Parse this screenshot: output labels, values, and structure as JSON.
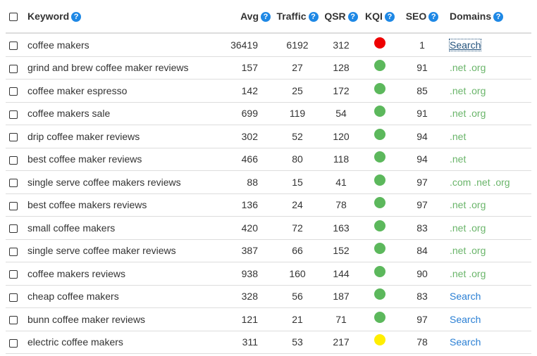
{
  "colors": {
    "help_icon": "#1e88e5",
    "kqi_green": "#5cb85c",
    "kqi_red": "#ee0000",
    "kqi_yellow": "#ffee00",
    "domain_text": "#6ab56a",
    "link": "#2a7fd4"
  },
  "header": {
    "select_all_icon": "checkbox-icon",
    "help_glyph": "?",
    "columns": [
      {
        "key": "keyword",
        "label": "Keyword"
      },
      {
        "key": "avg",
        "label": "Avg"
      },
      {
        "key": "traffic",
        "label": "Traffic"
      },
      {
        "key": "qsr",
        "label": "QSR"
      },
      {
        "key": "kqi",
        "label": "KQI"
      },
      {
        "key": "seo",
        "label": "SEO"
      },
      {
        "key": "domains",
        "label": "Domains"
      }
    ]
  },
  "rows": [
    {
      "keyword": "coffee makers",
      "avg": "36419",
      "traffic": "6192",
      "qsr": "312",
      "kqi": "red",
      "seo": "1",
      "domains": "",
      "search": "Search"
    },
    {
      "keyword": "grind and brew coffee maker reviews",
      "avg": "157",
      "traffic": "27",
      "qsr": "128",
      "kqi": "green",
      "seo": "91",
      "domains": ".net .org",
      "search": ""
    },
    {
      "keyword": "coffee maker espresso",
      "avg": "142",
      "traffic": "25",
      "qsr": "172",
      "kqi": "green",
      "seo": "85",
      "domains": ".net .org",
      "search": ""
    },
    {
      "keyword": "coffee makers sale",
      "avg": "699",
      "traffic": "119",
      "qsr": "54",
      "kqi": "green",
      "seo": "91",
      "domains": ".net .org",
      "search": ""
    },
    {
      "keyword": "drip coffee maker reviews",
      "avg": "302",
      "traffic": "52",
      "qsr": "120",
      "kqi": "green",
      "seo": "94",
      "domains": ".net",
      "search": ""
    },
    {
      "keyword": "best coffee maker reviews",
      "avg": "466",
      "traffic": "80",
      "qsr": "118",
      "kqi": "green",
      "seo": "94",
      "domains": ".net",
      "search": ""
    },
    {
      "keyword": "single serve coffee makers reviews",
      "avg": "88",
      "traffic": "15",
      "qsr": "41",
      "kqi": "green",
      "seo": "97",
      "domains": ".com .net .org",
      "search": ""
    },
    {
      "keyword": "best coffee makers reviews",
      "avg": "136",
      "traffic": "24",
      "qsr": "78",
      "kqi": "green",
      "seo": "97",
      "domains": ".net .org",
      "search": ""
    },
    {
      "keyword": "small coffee makers",
      "avg": "420",
      "traffic": "72",
      "qsr": "163",
      "kqi": "green",
      "seo": "83",
      "domains": ".net .org",
      "search": ""
    },
    {
      "keyword": "single serve coffee maker reviews",
      "avg": "387",
      "traffic": "66",
      "qsr": "152",
      "kqi": "green",
      "seo": "84",
      "domains": ".net .org",
      "search": ""
    },
    {
      "keyword": "coffee makers reviews",
      "avg": "938",
      "traffic": "160",
      "qsr": "144",
      "kqi": "green",
      "seo": "90",
      "domains": ".net .org",
      "search": ""
    },
    {
      "keyword": "cheap coffee makers",
      "avg": "328",
      "traffic": "56",
      "qsr": "187",
      "kqi": "green",
      "seo": "83",
      "domains": "",
      "search": "Search"
    },
    {
      "keyword": "bunn coffee maker reviews",
      "avg": "121",
      "traffic": "21",
      "qsr": "71",
      "kqi": "green",
      "seo": "97",
      "domains": "",
      "search": "Search"
    },
    {
      "keyword": "electric coffee makers",
      "avg": "311",
      "traffic": "53",
      "qsr": "217",
      "kqi": "yellow",
      "seo": "78",
      "domains": "",
      "search": "Search"
    }
  ]
}
